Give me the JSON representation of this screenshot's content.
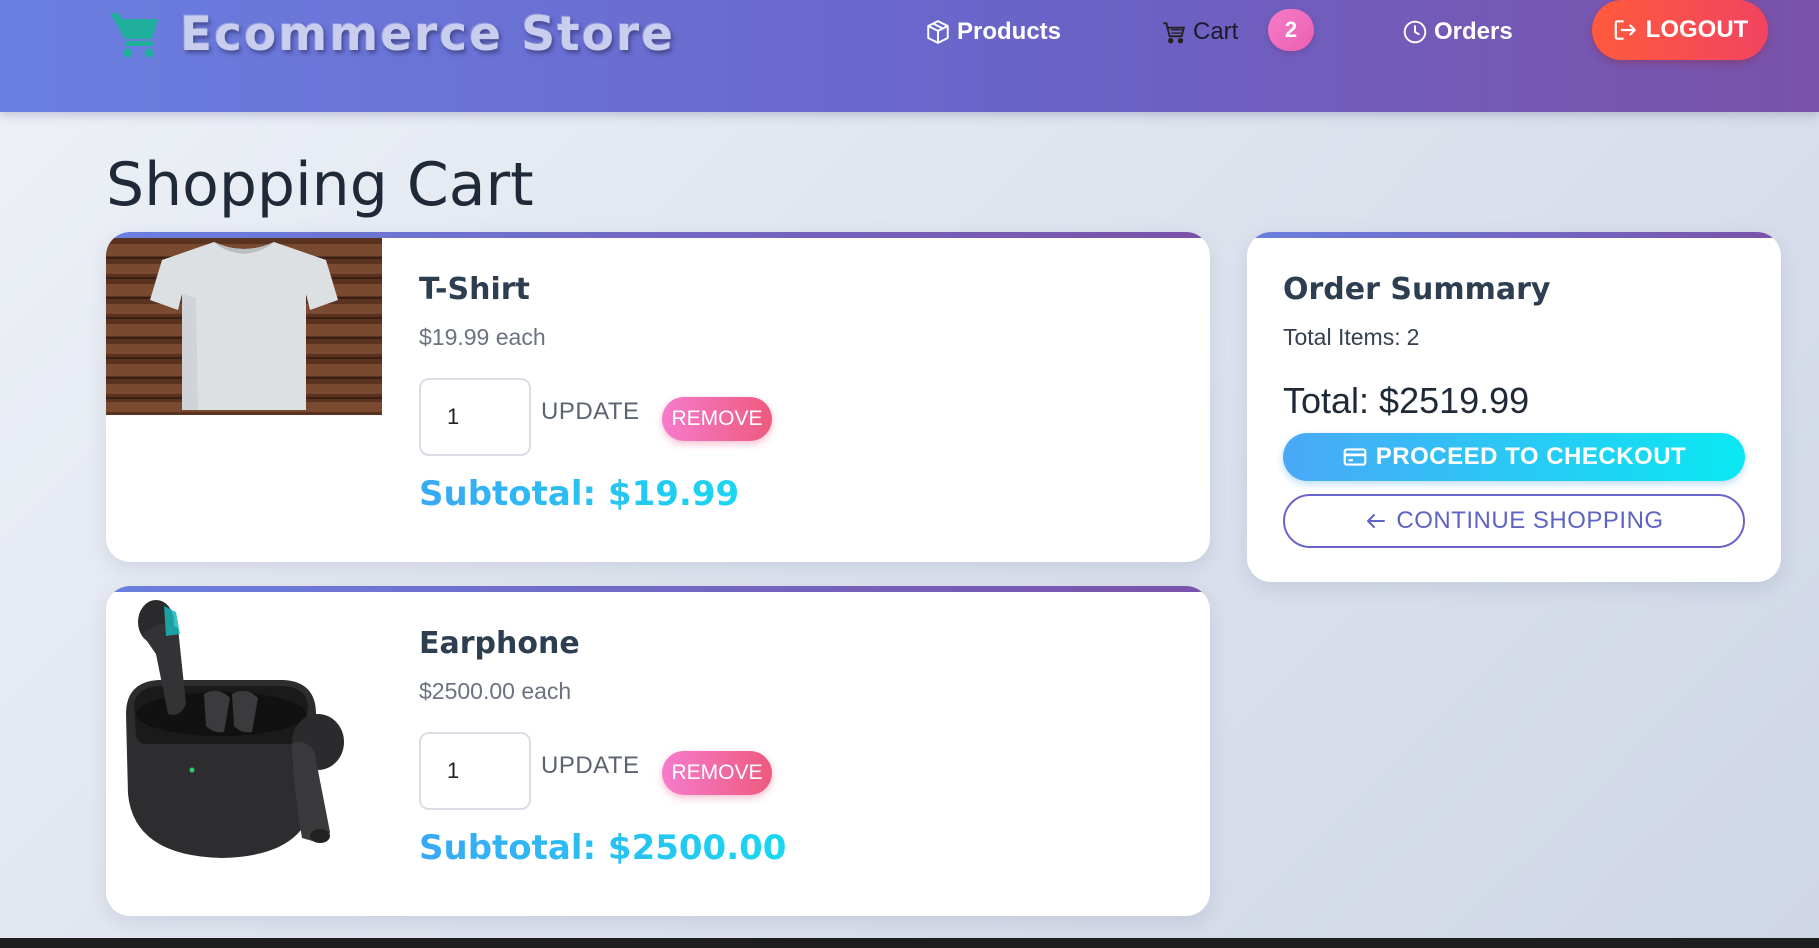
{
  "header": {
    "brand": "Ecommerce Store",
    "brand_icon": "shopping-cart-icon",
    "nav": {
      "products": "Products",
      "cart": "Cart",
      "cart_count": "2",
      "orders": "Orders",
      "logout": "LOGOUT"
    },
    "colors": {
      "gradient_start": "#6a7fe0",
      "gradient_end": "#7a52a9",
      "brand_icon": "#1fae9b"
    }
  },
  "page": {
    "title": "Shopping Cart"
  },
  "cart": {
    "items": [
      {
        "name": "T-Shirt",
        "price": "$19.99 each",
        "quantity": "1",
        "update_label": "UPDATE",
        "remove_label": "REMOVE",
        "subtotal": "Subtotal: $19.99"
      },
      {
        "name": "Earphone",
        "price": "$2500.00 each",
        "quantity": "1",
        "update_label": "UPDATE",
        "remove_label": "REMOVE",
        "subtotal": "Subtotal: $2500.00"
      }
    ]
  },
  "summary": {
    "title": "Order Summary",
    "total_items_label": "Total Items:",
    "total_items": "2",
    "total_label": "Total:",
    "total": "$2519.99",
    "checkout": "PROCEED TO CHECKOUT",
    "continue": "CONTINUE SHOPPING"
  }
}
